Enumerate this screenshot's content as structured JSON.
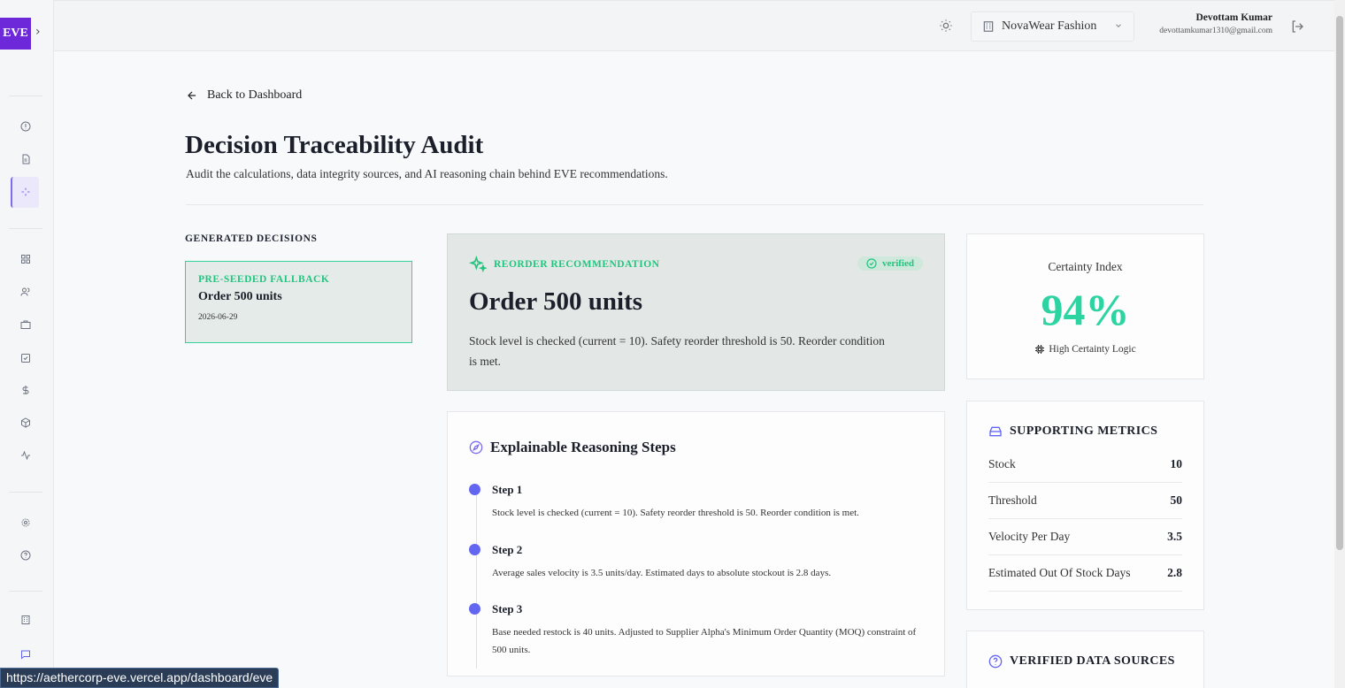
{
  "sidebar": {
    "logo": "EVE",
    "expand_icon": "chevron-right-icon",
    "icons": [
      "compass-icon",
      "document-icon",
      "sparkle-icon",
      "grid-icon",
      "users-icon",
      "briefcase-icon",
      "checkbox-icon",
      "dollar-icon",
      "package-icon",
      "activity-icon",
      "gear-icon",
      "help-icon",
      "building-icon",
      "chat-icon"
    ]
  },
  "header": {
    "theme_icon": "sun-icon",
    "org": "NovaWear Fashion",
    "user_name": "Devottam Kumar",
    "user_email": "devottamkumar1310@gmail.com"
  },
  "page": {
    "back_label": "Back to Dashboard",
    "title": "Decision Traceability Audit",
    "subtitle": "Audit the calculations, data integrity sources, and AI reasoning chain behind EVE recommendations."
  },
  "generated": {
    "heading": "GENERATED DECISIONS",
    "items": [
      {
        "tag": "PRE-SEEDED FALLBACK",
        "title": "Order 500 units",
        "date": "2026-06-29"
      }
    ]
  },
  "recommendation": {
    "tag": "REORDER RECOMMENDATION",
    "status": "verified",
    "title": "Order 500 units",
    "description": "Stock level is checked (current = 10). Safety reorder threshold is 50. Reorder condition is met."
  },
  "reasoning": {
    "heading": "Explainable Reasoning Steps",
    "steps": [
      {
        "label": "Step 1",
        "text": "Stock level is checked (current = 10). Safety reorder threshold is 50. Reorder condition is met."
      },
      {
        "label": "Step 2",
        "text": "Average sales velocity is 3.5 units/day. Estimated days to absolute stockout is 2.8 days."
      },
      {
        "label": "Step 3",
        "text": "Base needed restock is 40 units. Adjusted to Supplier Alpha's Minimum Order Quantity (MOQ) constraint of 500 units."
      }
    ]
  },
  "certainty": {
    "label": "Certainty Index",
    "value": "94%",
    "logic": "High Certainty Logic"
  },
  "metrics": {
    "heading": "SUPPORTING METRICS",
    "rows": [
      {
        "name": "Stock",
        "value": "10"
      },
      {
        "name": "Threshold",
        "value": "50"
      },
      {
        "name": "Velocity Per Day",
        "value": "3.5"
      },
      {
        "name": "Estimated Out Of Stock Days",
        "value": "2.8"
      }
    ]
  },
  "sources": {
    "heading": "VERIFIED DATA SOURCES"
  },
  "status_bar": {
    "url": "https://aethercorp-eve.vercel.app/dashboard/eve"
  },
  "colors": {
    "accent": "#6366f1",
    "success": "#22c57f",
    "brand": "#6d28d9"
  }
}
